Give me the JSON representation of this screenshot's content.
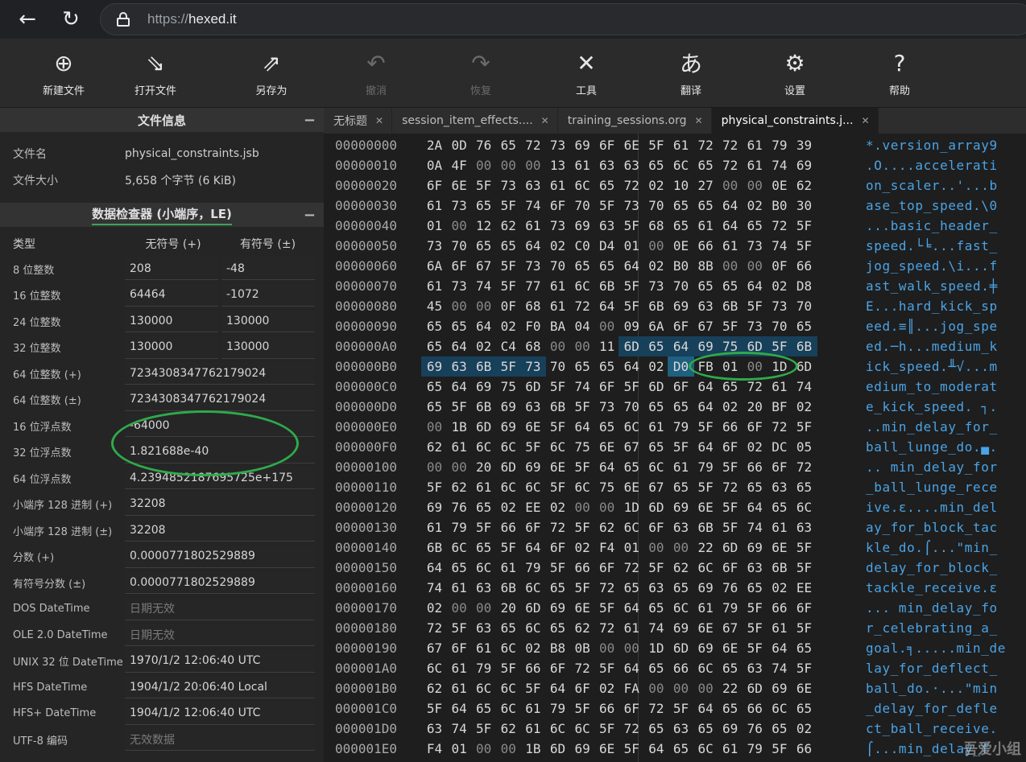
{
  "browser": {
    "url_scheme": "https://",
    "url_host": "hexed.it"
  },
  "toolbar": [
    {
      "label": "新建文件",
      "icon": "new-file-icon",
      "glyph": "⊕",
      "enabled": true
    },
    {
      "label": "打开文件",
      "icon": "open-file-icon",
      "glyph": "⇘",
      "enabled": true
    },
    {
      "label": "另存为",
      "icon": "save-as-icon",
      "glyph": "⇗",
      "enabled": true
    },
    {
      "label": "撤消",
      "icon": "undo-icon",
      "glyph": "↶",
      "enabled": false
    },
    {
      "label": "恢复",
      "icon": "redo-icon",
      "glyph": "↷",
      "enabled": false
    },
    {
      "label": "工具",
      "icon": "tools-icon",
      "glyph": "✕",
      "enabled": true
    },
    {
      "label": "翻译",
      "icon": "translate-icon",
      "glyph": "あ",
      "enabled": true
    },
    {
      "label": "设置",
      "icon": "gear-icon",
      "glyph": "⚙",
      "enabled": true
    },
    {
      "label": "帮助",
      "icon": "help-icon",
      "glyph": "?",
      "enabled": true
    }
  ],
  "file_info": {
    "title": "文件信息",
    "name_label": "文件名",
    "name_value": "physical_constraints.jsb",
    "size_label": "文件大小",
    "size_value": "5,658 个字节 (6 KiB)"
  },
  "inspector": {
    "title": "数据检查器 (小端序，LE)",
    "col_type": "类型",
    "col_unsigned": "无符号 (+)",
    "col_signed": "有符号 (±)",
    "rows": [
      {
        "type": "8 位整数",
        "unsigned": "208",
        "signed": "-48"
      },
      {
        "type": "16 位整数",
        "unsigned": "64464",
        "signed": "-1072"
      },
      {
        "type": "24 位整数",
        "unsigned": "130000",
        "signed": "130000"
      },
      {
        "type": "32 位整数",
        "unsigned": "130000",
        "signed": "130000"
      },
      {
        "type": "64 位整数 (+)",
        "value": "7234308347762179024"
      },
      {
        "type": "64 位整数 (±)",
        "value": "7234308347762179024"
      },
      {
        "type": "16 位浮点数",
        "value": "-64000"
      },
      {
        "type": "32 位浮点数",
        "value": "1.821688e-40"
      },
      {
        "type": "64 位浮点数",
        "value": "4.2394852187695725e+175"
      },
      {
        "type": "小端序 128 进制 (+)",
        "value": "32208"
      },
      {
        "type": "小端序 128 进制 (±)",
        "value": "32208"
      },
      {
        "type": "分数 (+)",
        "value": "0.0000771802529889"
      },
      {
        "type": "有符号分数 (±)",
        "value": "0.0000771802529889"
      },
      {
        "type": "DOS DateTime",
        "value": "日期无效",
        "muted": true
      },
      {
        "type": "OLE 2.0 DateTime",
        "value": "日期无效",
        "muted": true
      },
      {
        "type": "UNIX 32 位 DateTime",
        "value": "1970/1/2 12:06:40 UTC"
      },
      {
        "type": "HFS DateTime",
        "value": "1904/1/2 20:06:40 Local"
      },
      {
        "type": "HFS+ DateTime",
        "value": "1904/1/2 12:06:40 UTC"
      },
      {
        "type": "UTF-8 编码",
        "value": "无效数据",
        "muted": true
      }
    ]
  },
  "tabs": [
    {
      "label": "无标题",
      "active": false
    },
    {
      "label": "session_item_effects....",
      "active": false
    },
    {
      "label": "training_sessions.org",
      "active": false
    },
    {
      "label": "physical_constraints.j...",
      "active": true
    }
  ],
  "hex_rows": [
    {
      "addr": "00000000",
      "bytes": [
        "2A",
        "0D",
        "76",
        "65",
        "72",
        "73",
        "69",
        "6F",
        "6E",
        "5F",
        "61",
        "72",
        "72",
        "61",
        "79",
        "39"
      ],
      "ascii": "*.version_array9"
    },
    {
      "addr": "00000010",
      "bytes": [
        "0A",
        "4F",
        "00",
        "00",
        "00",
        "13",
        "61",
        "63",
        "63",
        "65",
        "6C",
        "65",
        "72",
        "61",
        "74",
        "69"
      ],
      "ascii": ".O....accelerati"
    },
    {
      "addr": "00000020",
      "bytes": [
        "6F",
        "6E",
        "5F",
        "73",
        "63",
        "61",
        "6C",
        "65",
        "72",
        "02",
        "10",
        "27",
        "00",
        "00",
        "0E",
        "62"
      ],
      "ascii": "on_scaler..'...b"
    },
    {
      "addr": "00000030",
      "bytes": [
        "61",
        "73",
        "65",
        "5F",
        "74",
        "6F",
        "70",
        "5F",
        "73",
        "70",
        "65",
        "65",
        "64",
        "02",
        "B0",
        "30"
      ],
      "ascii": "ase_top_speed.\\0"
    },
    {
      "addr": "00000040",
      "bytes": [
        "01",
        "00",
        "12",
        "62",
        "61",
        "73",
        "69",
        "63",
        "5F",
        "68",
        "65",
        "61",
        "64",
        "65",
        "72",
        "5F"
      ],
      "ascii": "...basic_header_"
    },
    {
      "addr": "00000050",
      "bytes": [
        "73",
        "70",
        "65",
        "65",
        "64",
        "02",
        "C0",
        "D4",
        "01",
        "00",
        "0E",
        "66",
        "61",
        "73",
        "74",
        "5F"
      ],
      "ascii": "speed.└╘...fast_"
    },
    {
      "addr": "00000060",
      "bytes": [
        "6A",
        "6F",
        "67",
        "5F",
        "73",
        "70",
        "65",
        "65",
        "64",
        "02",
        "B0",
        "8B",
        "00",
        "00",
        "0F",
        "66"
      ],
      "ascii": "jog_speed.\\i...f"
    },
    {
      "addr": "00000070",
      "bytes": [
        "61",
        "73",
        "74",
        "5F",
        "77",
        "61",
        "6C",
        "6B",
        "5F",
        "73",
        "70",
        "65",
        "65",
        "64",
        "02",
        "D8"
      ],
      "ascii": "ast_walk_speed.╪"
    },
    {
      "addr": "00000080",
      "bytes": [
        "45",
        "00",
        "00",
        "0F",
        "68",
        "61",
        "72",
        "64",
        "5F",
        "6B",
        "69",
        "63",
        "6B",
        "5F",
        "73",
        "70"
      ],
      "ascii": "E...hard_kick_sp"
    },
    {
      "addr": "00000090",
      "bytes": [
        "65",
        "65",
        "64",
        "02",
        "F0",
        "BA",
        "04",
        "00",
        "09",
        "6A",
        "6F",
        "67",
        "5F",
        "73",
        "70",
        "65"
      ],
      "ascii": "eed.≡║...jog_spe"
    },
    {
      "addr": "000000A0",
      "bytes": [
        "65",
        "64",
        "02",
        "C4",
        "68",
        "00",
        "00",
        "11",
        "6D",
        "65",
        "64",
        "69",
        "75",
        "6D",
        "5F",
        "6B"
      ],
      "ascii": "ed.─h...medium_k"
    },
    {
      "addr": "000000B0",
      "bytes": [
        "69",
        "63",
        "6B",
        "5F",
        "73",
        "70",
        "65",
        "65",
        "64",
        "02",
        "D0",
        "FB",
        "01",
        "00",
        "1D",
        "6D"
      ],
      "ascii": "ick_speed.╨√...m"
    },
    {
      "addr": "000000C0",
      "bytes": [
        "65",
        "64",
        "69",
        "75",
        "6D",
        "5F",
        "74",
        "6F",
        "5F",
        "6D",
        "6F",
        "64",
        "65",
        "72",
        "61",
        "74"
      ],
      "ascii": "edium_to_moderat"
    },
    {
      "addr": "000000D0",
      "bytes": [
        "65",
        "5F",
        "6B",
        "69",
        "63",
        "6B",
        "5F",
        "73",
        "70",
        "65",
        "65",
        "64",
        "02",
        "20",
        "BF",
        "02"
      ],
      "ascii": "e_kick_speed. ┐."
    },
    {
      "addr": "000000E0",
      "bytes": [
        "00",
        "1B",
        "6D",
        "69",
        "6E",
        "5F",
        "64",
        "65",
        "6C",
        "61",
        "79",
        "5F",
        "66",
        "6F",
        "72",
        "5F"
      ],
      "ascii": "..min_delay_for_"
    },
    {
      "addr": "000000F0",
      "bytes": [
        "62",
        "61",
        "6C",
        "6C",
        "5F",
        "6C",
        "75",
        "6E",
        "67",
        "65",
        "5F",
        "64",
        "6F",
        "02",
        "DC",
        "05"
      ],
      "ascii": "ball_lunge_do.▄."
    },
    {
      "addr": "00000100",
      "bytes": [
        "00",
        "00",
        "20",
        "6D",
        "69",
        "6E",
        "5F",
        "64",
        "65",
        "6C",
        "61",
        "79",
        "5F",
        "66",
        "6F",
        "72"
      ],
      "ascii": ".. min_delay_for"
    },
    {
      "addr": "00000110",
      "bytes": [
        "5F",
        "62",
        "61",
        "6C",
        "6C",
        "5F",
        "6C",
        "75",
        "6E",
        "67",
        "65",
        "5F",
        "72",
        "65",
        "63",
        "65"
      ],
      "ascii": "_ball_lunge_rece"
    },
    {
      "addr": "00000120",
      "bytes": [
        "69",
        "76",
        "65",
        "02",
        "EE",
        "02",
        "00",
        "00",
        "1D",
        "6D",
        "69",
        "6E",
        "5F",
        "64",
        "65",
        "6C"
      ],
      "ascii": "ive.ε....min_del"
    },
    {
      "addr": "00000130",
      "bytes": [
        "61",
        "79",
        "5F",
        "66",
        "6F",
        "72",
        "5F",
        "62",
        "6C",
        "6F",
        "63",
        "6B",
        "5F",
        "74",
        "61",
        "63"
      ],
      "ascii": "ay_for_block_tac"
    },
    {
      "addr": "00000140",
      "bytes": [
        "6B",
        "6C",
        "65",
        "5F",
        "64",
        "6F",
        "02",
        "F4",
        "01",
        "00",
        "00",
        "22",
        "6D",
        "69",
        "6E",
        "5F"
      ],
      "ascii": "kle_do.⌠...\"min_"
    },
    {
      "addr": "00000150",
      "bytes": [
        "64",
        "65",
        "6C",
        "61",
        "79",
        "5F",
        "66",
        "6F",
        "72",
        "5F",
        "62",
        "6C",
        "6F",
        "63",
        "6B",
        "5F"
      ],
      "ascii": "delay_for_block_"
    },
    {
      "addr": "00000160",
      "bytes": [
        "74",
        "61",
        "63",
        "6B",
        "6C",
        "65",
        "5F",
        "72",
        "65",
        "63",
        "65",
        "69",
        "76",
        "65",
        "02",
        "EE"
      ],
      "ascii": "tackle_receive.ε"
    },
    {
      "addr": "00000170",
      "bytes": [
        "02",
        "00",
        "00",
        "20",
        "6D",
        "69",
        "6E",
        "5F",
        "64",
        "65",
        "6C",
        "61",
        "79",
        "5F",
        "66",
        "6F"
      ],
      "ascii": "... min_delay_fo"
    },
    {
      "addr": "00000180",
      "bytes": [
        "72",
        "5F",
        "63",
        "65",
        "6C",
        "65",
        "62",
        "72",
        "61",
        "74",
        "69",
        "6E",
        "67",
        "5F",
        "61",
        "5F"
      ],
      "ascii": "r_celebrating_a_"
    },
    {
      "addr": "00000190",
      "bytes": [
        "67",
        "6F",
        "61",
        "6C",
        "02",
        "B8",
        "0B",
        "00",
        "00",
        "1D",
        "6D",
        "69",
        "6E",
        "5F",
        "64",
        "65"
      ],
      "ascii": "goal.╕.....min_de"
    },
    {
      "addr": "000001A0",
      "bytes": [
        "6C",
        "61",
        "79",
        "5F",
        "66",
        "6F",
        "72",
        "5F",
        "64",
        "65",
        "66",
        "6C",
        "65",
        "63",
        "74",
        "5F"
      ],
      "ascii": "lay_for_deflect_"
    },
    {
      "addr": "000001B0",
      "bytes": [
        "62",
        "61",
        "6C",
        "6C",
        "5F",
        "64",
        "6F",
        "02",
        "FA",
        "00",
        "00",
        "00",
        "22",
        "6D",
        "69",
        "6E"
      ],
      "ascii": "ball_do.·...\"min"
    },
    {
      "addr": "000001C0",
      "bytes": [
        "5F",
        "64",
        "65",
        "6C",
        "61",
        "79",
        "5F",
        "66",
        "6F",
        "72",
        "5F",
        "64",
        "65",
        "66",
        "6C",
        "65"
      ],
      "ascii": "_delay_for_defle"
    },
    {
      "addr": "000001D0",
      "bytes": [
        "63",
        "74",
        "5F",
        "62",
        "61",
        "6C",
        "6C",
        "5F",
        "72",
        "65",
        "63",
        "65",
        "69",
        "76",
        "65",
        "02"
      ],
      "ascii": "ct_ball_receive."
    },
    {
      "addr": "000001E0",
      "bytes": [
        "F4",
        "01",
        "00",
        "00",
        "1B",
        "6D",
        "69",
        "6E",
        "5F",
        "64",
        "65",
        "6C",
        "61",
        "79",
        "5F",
        "66"
      ],
      "ascii": "⌠...min_delay_f"
    }
  ],
  "selection": {
    "start": 168,
    "end": 180,
    "cursor": 186
  },
  "watermark": "吾爱小组",
  "colors": {
    "accent_green": "#2faa4a",
    "ascii_blue": "#4aa3e6",
    "selection": "#17405a"
  }
}
